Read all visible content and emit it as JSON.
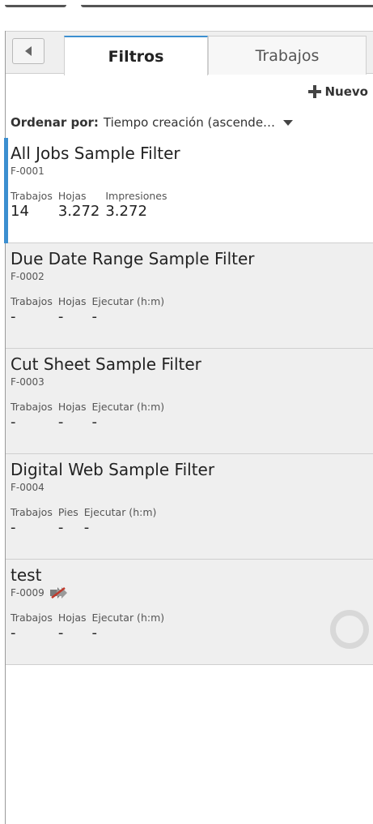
{
  "tabs": {
    "active": "Filtros",
    "inactive": "Trabajos"
  },
  "new_button": {
    "label": "Nuevo"
  },
  "sort": {
    "label": "Ordenar por:",
    "value": "Tiempo creación (ascende…"
  },
  "filters": [
    {
      "name": "All Jobs Sample Filter",
      "code": "F-0001",
      "metrics": [
        {
          "label": "Trabajos",
          "value": "14"
        },
        {
          "label": "Hojas",
          "value": "3.272"
        },
        {
          "label": "Impresiones",
          "value": "3.272"
        }
      ]
    },
    {
      "name": "Due Date Range Sample Filter",
      "code": "F-0002",
      "metrics": [
        {
          "label": "Trabajos",
          "value": "-"
        },
        {
          "label": "Hojas",
          "value": "-"
        },
        {
          "label": "Ejecutar (h:m)",
          "value": "-"
        }
      ]
    },
    {
      "name": "Cut Sheet Sample Filter",
      "code": "F-0003",
      "metrics": [
        {
          "label": "Trabajos",
          "value": "-"
        },
        {
          "label": "Hojas",
          "value": "-"
        },
        {
          "label": "Ejecutar (h:m)",
          "value": "-"
        }
      ]
    },
    {
      "name": "Digital Web Sample Filter",
      "code": "F-0004",
      "metrics": [
        {
          "label": "Trabajos",
          "value": "-"
        },
        {
          "label": "Pies",
          "value": "-"
        },
        {
          "label": "Ejecutar (h:m)",
          "value": "-"
        }
      ]
    },
    {
      "name": "test",
      "code": "F-0009",
      "metrics": [
        {
          "label": "Trabajos",
          "value": "-"
        },
        {
          "label": "Hojas",
          "value": "-"
        },
        {
          "label": "Ejecutar (h:m)",
          "value": "-"
        }
      ]
    }
  ],
  "icons": {
    "back": "chevron-left-icon",
    "new": "plus-icon",
    "sort": "caret-down-icon",
    "disabled": "disabled-arrow-icon",
    "loading": "loading-ring-icon"
  },
  "colors": {
    "accent": "#3c8fd0",
    "disabled_slash": "#c0392b"
  }
}
